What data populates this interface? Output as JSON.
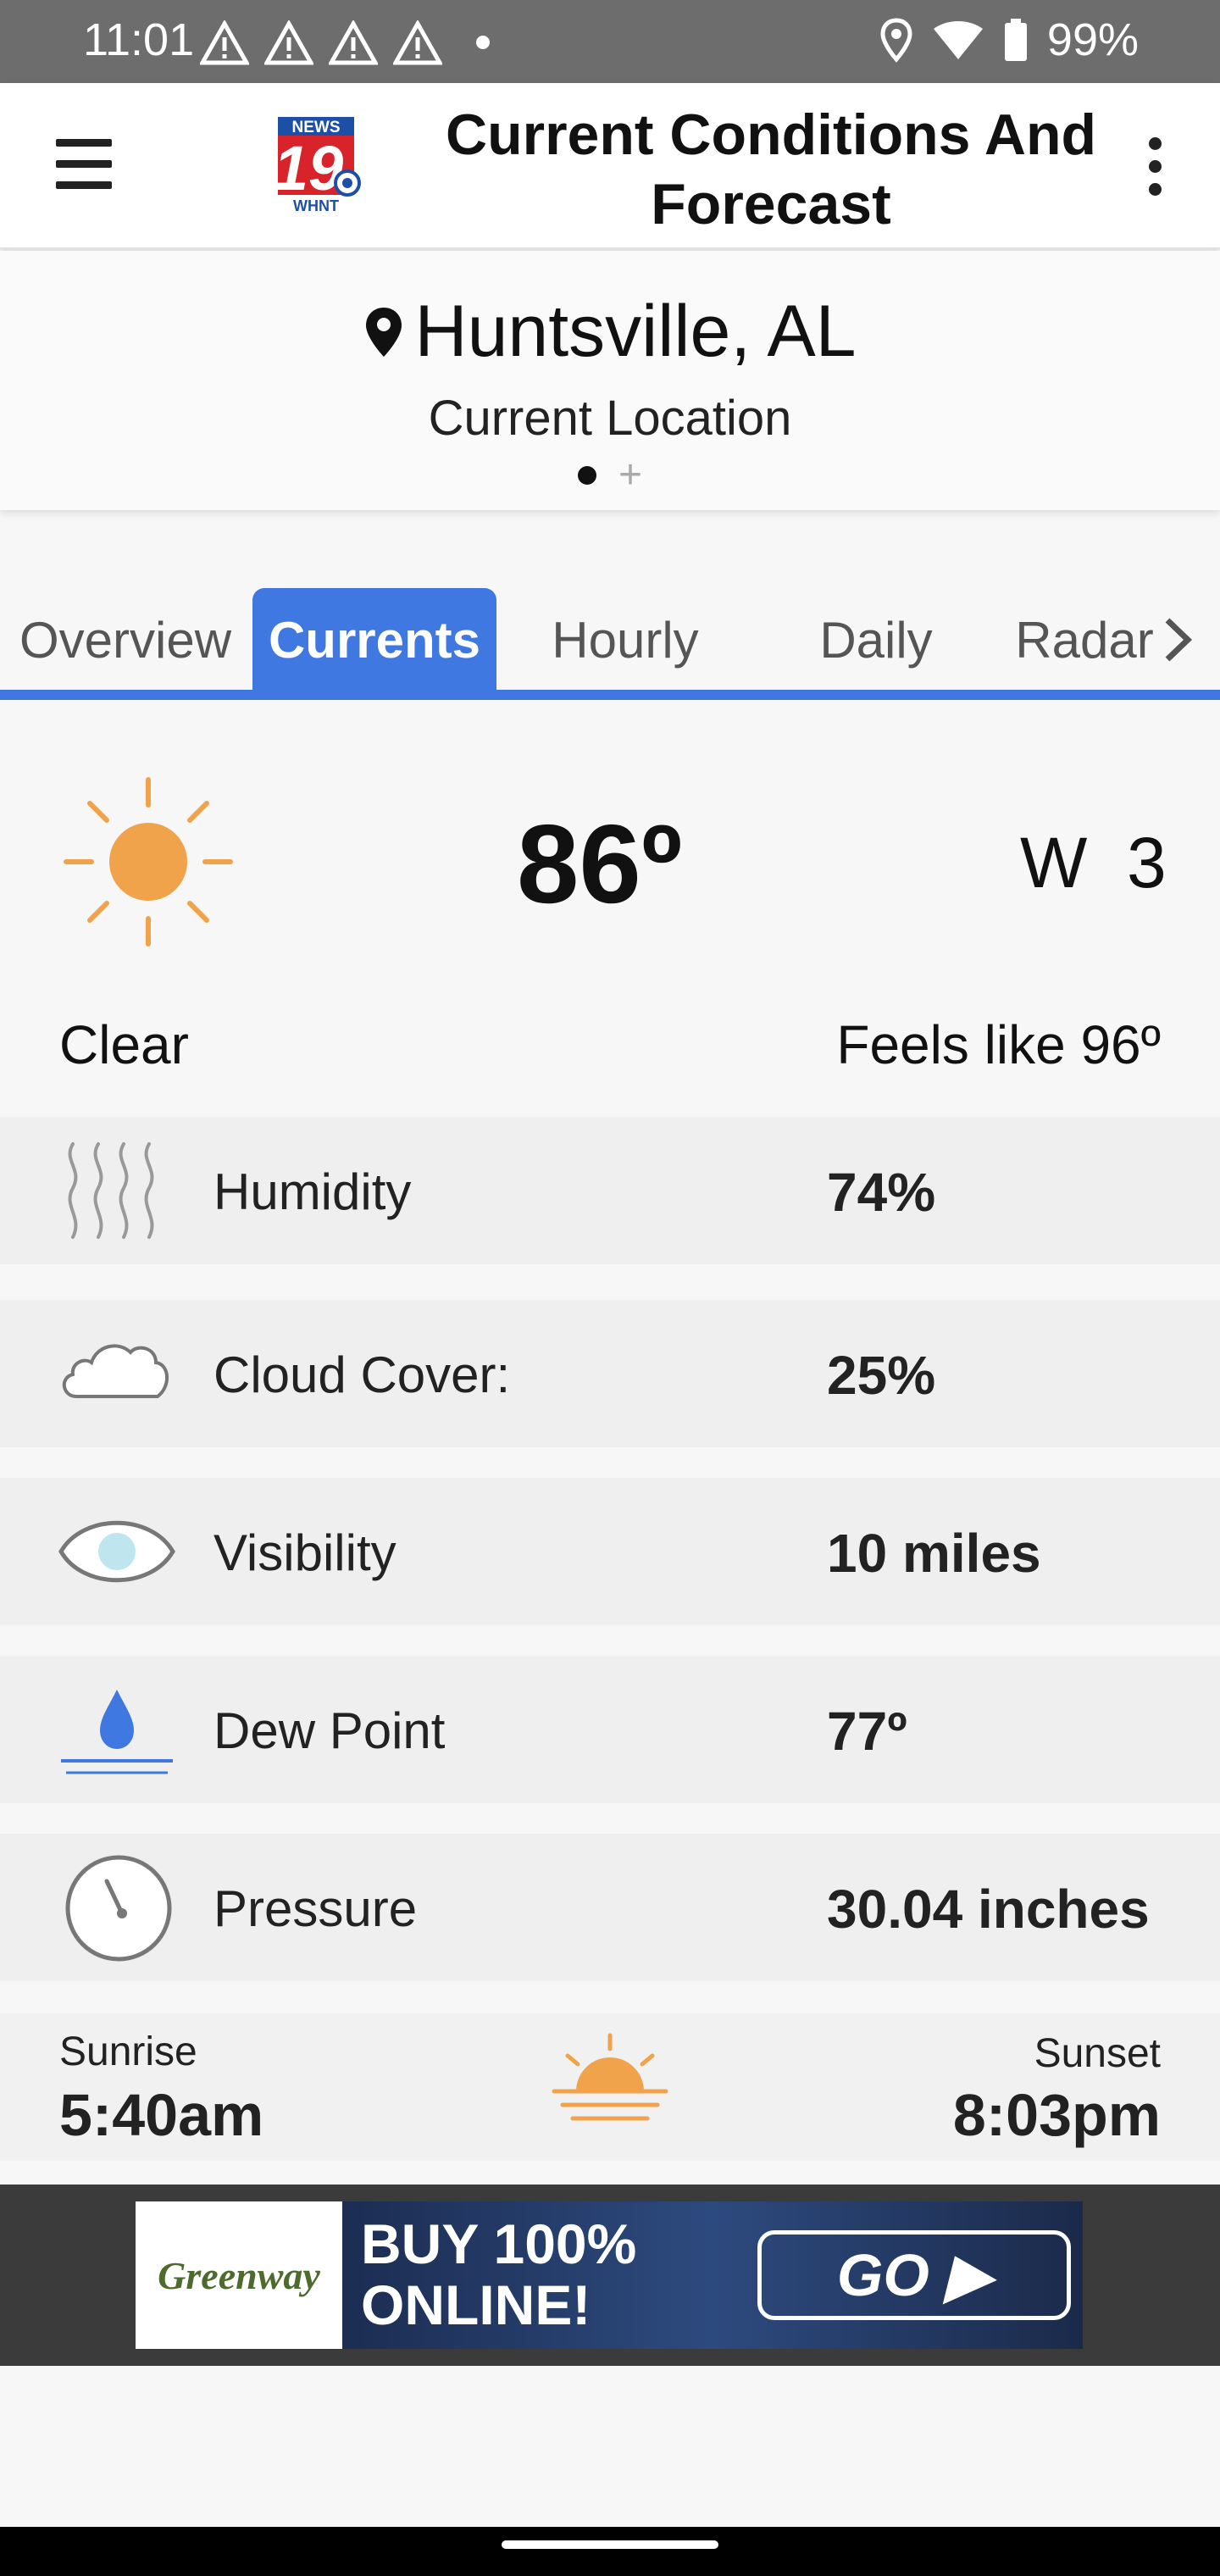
{
  "status_bar": {
    "time": "11:01",
    "battery": "99%",
    "icons": [
      "warning-icon",
      "warning-icon",
      "warning-icon",
      "warning-icon",
      "location-icon",
      "wifi-icon",
      "battery-icon"
    ]
  },
  "app_bar": {
    "title": "Current Conditions And Forecast",
    "logo_top": "NEWS",
    "logo_number": "19",
    "logo_bottom": "WHNT"
  },
  "location": {
    "name": "Huntsville, AL",
    "subtitle": "Current Location",
    "add_symbol": "+"
  },
  "tabs": [
    {
      "label": "Overview",
      "active": false
    },
    {
      "label": "Currents",
      "active": true
    },
    {
      "label": "Hourly",
      "active": false
    },
    {
      "label": "Daily",
      "active": false
    },
    {
      "label": "Radar",
      "active": false
    }
  ],
  "current": {
    "temperature": "86º",
    "wind": "W  3",
    "condition": "Clear",
    "feels_like": "Feels like 96º"
  },
  "details": [
    {
      "icon": "humidity-icon",
      "label": "Humidity",
      "value": "74%"
    },
    {
      "icon": "cloud-icon",
      "label": "Cloud Cover:",
      "value": "25%"
    },
    {
      "icon": "eye-icon",
      "label": "Visibility",
      "value": "10 miles"
    },
    {
      "icon": "dew-drop-icon",
      "label": "Dew Point",
      "value": "77º"
    },
    {
      "icon": "gauge-icon",
      "label": "Pressure",
      "value": "30.04 inches"
    }
  ],
  "sun": {
    "sunrise_label": "Sunrise",
    "sunrise_time": "5:40am",
    "sunset_label": "Sunset",
    "sunset_time": "8:03pm"
  },
  "ad": {
    "brand": "Greenway",
    "line1": "BUY 100%",
    "line2": "ONLINE!",
    "cta": "GO ▶"
  },
  "colors": {
    "accent": "#3f78e0",
    "sun": "#f0a34a",
    "status_bar": "#6d6d6d"
  }
}
